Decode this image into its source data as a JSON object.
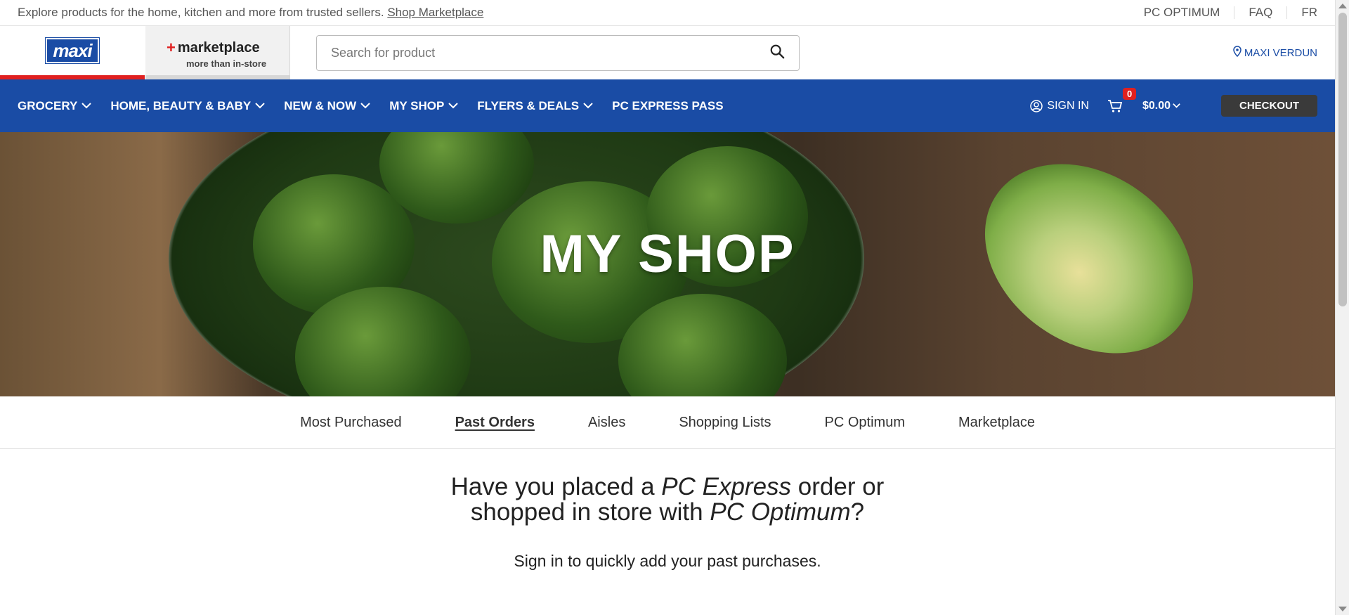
{
  "topbar": {
    "promo": "Explore products for the home, kitchen and more from trusted sellers.",
    "promo_link": "Shop Marketplace",
    "links": [
      "PC OPTIMUM",
      "FAQ",
      "FR"
    ]
  },
  "header": {
    "logo": "maxi",
    "marketplace_title": "marketplace",
    "marketplace_sub": "more than in-store",
    "search_placeholder": "Search for product",
    "store": "MAXI VERDUN"
  },
  "nav": {
    "items": [
      "GROCERY",
      "HOME, BEAUTY & BABY",
      "NEW & NOW",
      "MY SHOP",
      "FLYERS & DEALS",
      "PC EXPRESS PASS"
    ],
    "sign_in": "SIGN IN",
    "cart_count": "0",
    "cart_total": "$0.00",
    "checkout": "CHECKOUT"
  },
  "hero": {
    "title": "MY SHOP"
  },
  "tabs": {
    "items": [
      "Most Purchased",
      "Past Orders",
      "Aisles",
      "Shopping Lists",
      "PC Optimum",
      "Marketplace"
    ],
    "active": "Past Orders"
  },
  "content": {
    "headline_1": "Have you placed a ",
    "headline_2": "PC Express",
    "headline_3": " order or shopped in store with ",
    "headline_4": "PC Optimum",
    "headline_5": "?",
    "subtext": "Sign in to quickly add your past purchases."
  },
  "colors": {
    "brand_blue": "#1a4ca5",
    "brand_red": "#e02020",
    "checkout_bg": "#3a3a3a"
  }
}
